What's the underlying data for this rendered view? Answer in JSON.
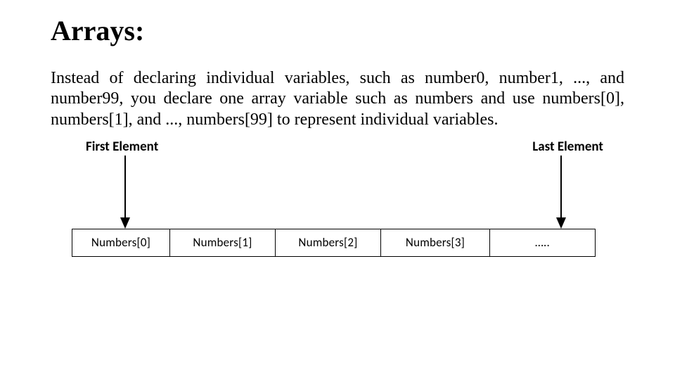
{
  "title": "Arrays:",
  "paragraph": "Instead of declaring individual variables, such as number0, number1, ..., and number99, you declare one array variable such as numbers and use numbers[0], numbers[1], and ..., numbers[99] to represent individual variables.",
  "diagram": {
    "first_label": "First Element",
    "last_label": "Last Element",
    "cells": [
      "Numbers[0]",
      "Numbers[1]",
      "Numbers[2]",
      "Numbers[3]",
      "….."
    ]
  }
}
